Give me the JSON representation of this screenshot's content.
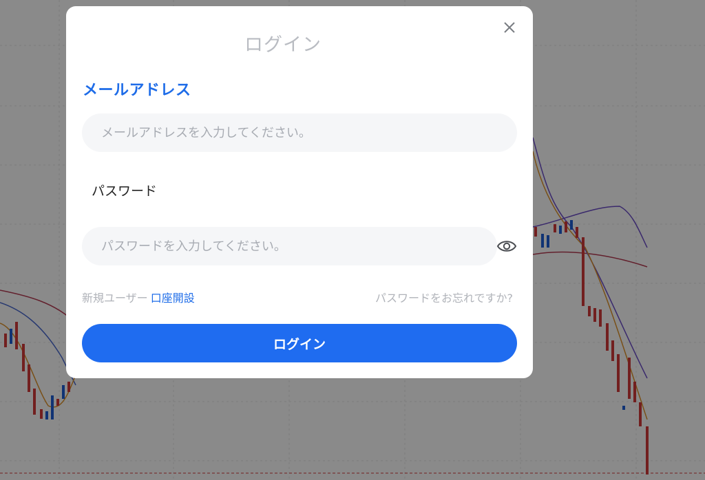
{
  "modal": {
    "title": "ログイン",
    "email_label": "メールアドレス",
    "email_placeholder": "メールアドレスを入力してください。",
    "password_label": "パスワード",
    "password_placeholder": "パスワードを入力してください。",
    "signup_prefix": "新規ユーザー",
    "signup_link": "口座開設",
    "forgot_password": "パスワードをお忘れですか?",
    "login_button": "ログイン",
    "close_icon": "close-icon",
    "toggle_icon": "eye-icon"
  },
  "colors": {
    "accent": "#1f6cf0",
    "label_blue": "#1e6ce8",
    "overlay": "rgba(0,0,0,0.46)",
    "bullish": "#1f5fd6",
    "bearish": "#d23a3a"
  }
}
